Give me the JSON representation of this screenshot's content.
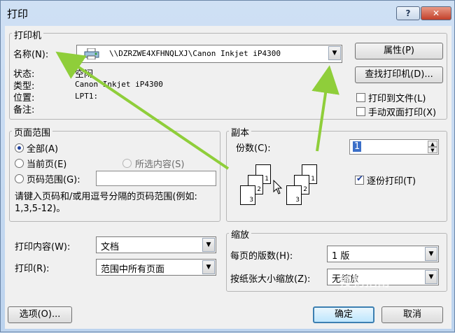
{
  "window": {
    "title": "打印",
    "help_label": "?",
    "close_label": "✕"
  },
  "printer": {
    "group_label": "打印机",
    "name_label": "名称(N):",
    "name_value": "\\\\DZRZWE4XFHNQLXJ\\Canon Inkjet iP4300",
    "status_label": "状态:",
    "status_value": "空闲",
    "type_label": "类型:",
    "type_value": "Canon Inkjet iP4300",
    "location_label": "位置:",
    "location_value": "LPT1:",
    "comment_label": "备注:",
    "properties_button": "属性(P)",
    "find_printer_button": "查找打印机(D)...",
    "print_to_file_label": "打印到文件(L)",
    "manual_duplex_label": "手动双面打印(X)",
    "print_to_file_checked": false,
    "manual_duplex_checked": false
  },
  "page_range": {
    "group_label": "页面范围",
    "all_label": "全部(A)",
    "current_label": "当前页(E)",
    "selection_label": "所选内容(S)",
    "pages_label": "页码范围(G):",
    "pages_value": "",
    "hint": "请键入页码和/或用逗号分隔的页码范围(例如: 1,3,5-12)。",
    "selected": "all"
  },
  "copies": {
    "group_label": "副本",
    "count_label": "份数(C):",
    "count_value": "1",
    "collate_label": "逐份打印(T)",
    "collate_checked": true,
    "page_numbers": [
      "1",
      "2",
      "3",
      "1",
      "2",
      "3"
    ]
  },
  "print_what": {
    "label": "打印内容(W):",
    "value": "文档",
    "print_label": "打印(R):",
    "print_value": "范围中所有页面"
  },
  "zoom": {
    "group_label": "缩放",
    "pages_per_sheet_label": "每页的版数(H):",
    "pages_per_sheet_value": "1 版",
    "scale_label": "按纸张大小缩放(Z):",
    "scale_value": "无缩放"
  },
  "buttons": {
    "options": "选项(O)...",
    "ok": "确定",
    "cancel": "取消"
  },
  "watermark": "搜狗指南",
  "colors": {
    "title_bg": "#cfe0f4",
    "annotation_arrow": "#8fce3a",
    "default_button": "#3c7fb1"
  }
}
